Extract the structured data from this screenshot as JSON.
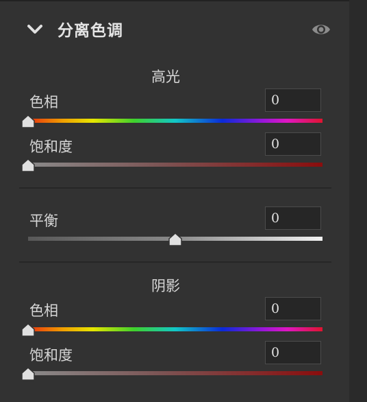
{
  "panel": {
    "title": "分离色调",
    "collapse_icon": "chevron-down-icon",
    "visibility_icon": "eye-icon"
  },
  "highlights": {
    "title": "高光",
    "hue": {
      "label": "色相",
      "value": "0"
    },
    "saturation": {
      "label": "饱和度",
      "value": "0"
    }
  },
  "balance": {
    "label": "平衡",
    "value": "0"
  },
  "shadows": {
    "title": "阴影",
    "hue": {
      "label": "色相",
      "value": "0"
    },
    "saturation": {
      "label": "饱和度",
      "value": "0"
    }
  },
  "colors": {
    "panel_bg": "#323232",
    "input_bg": "#262626",
    "text": "#d6d6d6",
    "thumb": "#e0e0e0"
  }
}
